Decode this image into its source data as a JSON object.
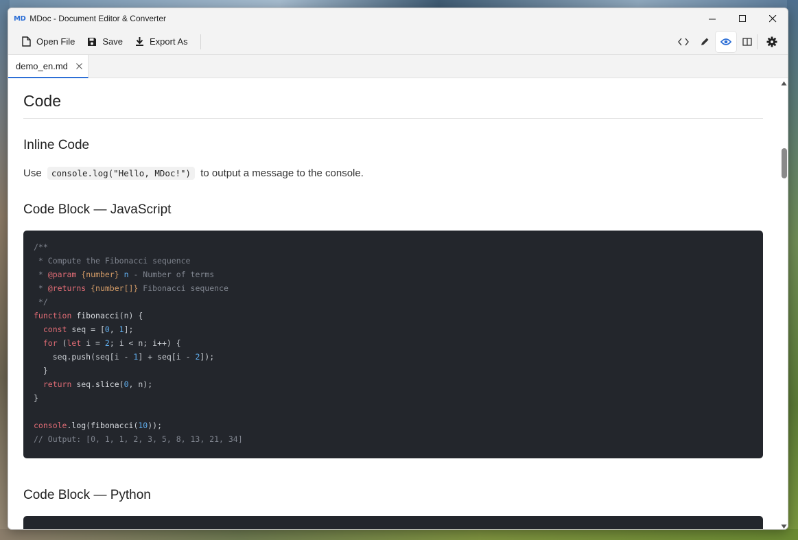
{
  "window": {
    "logo": "MD",
    "title": "MDoc - Document Editor & Converter"
  },
  "toolbar": {
    "open_label": "Open File",
    "save_label": "Save",
    "export_label": "Export As"
  },
  "tabs": [
    {
      "label": "demo_en.md",
      "active": true
    }
  ],
  "view_modes": [
    "source-icon",
    "edit-icon",
    "preview-icon",
    "split-icon"
  ],
  "active_view": "preview-icon",
  "doc": {
    "h1": "Code",
    "h2_inline": "Inline Code",
    "para_before": "Use",
    "inline_code": "console.log(\"Hello, MDoc!\")",
    "para_after": "to output a message to the console.",
    "h2_js": "Code Block — JavaScript",
    "h2_py": "Code Block — Python"
  },
  "colors": {
    "accent": "#2d6fd6",
    "code_bg": "#23262c",
    "keyword": "#e06c75",
    "comment": "#7f848e",
    "number": "#61afef",
    "type": "#d19a66"
  }
}
